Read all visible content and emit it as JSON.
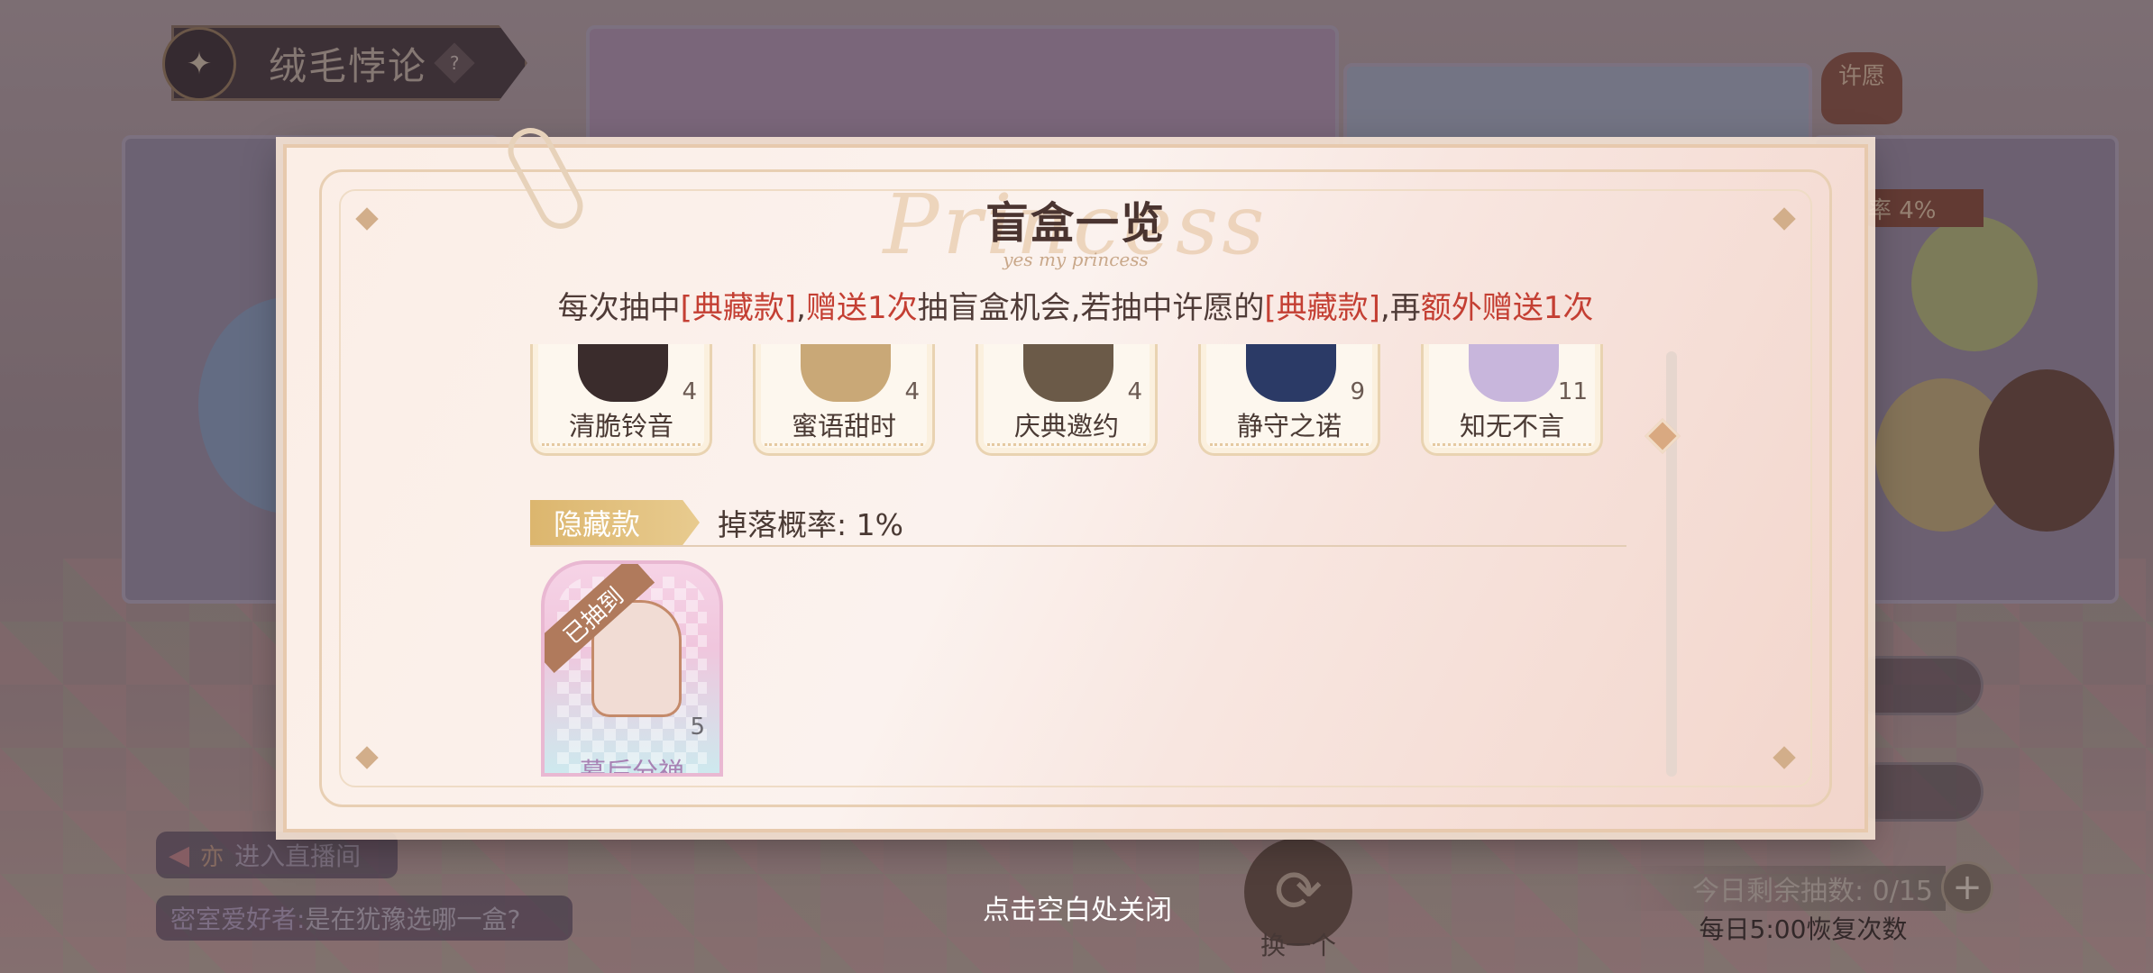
{
  "background": {
    "game_title": "绒毛悖论",
    "help_symbol": "?",
    "rate_badge": "率 4%",
    "wish_tag": "许愿",
    "live_button_tag": "亦",
    "live_button_label": "进入直播间",
    "chat_user": "密室爱好者:",
    "chat_message": "是在犹豫选哪一盒?",
    "swap_label": "换一个",
    "draws_remaining": "今日剩余抽数: 0/15",
    "plus_symbol": "+",
    "recover_text": "每日5:00恢复次数",
    "colors": {
      "accent_red": "#c43f33",
      "tag_gold": "#dcb66e",
      "modal_bg": "#fbeee6"
    }
  },
  "modal": {
    "title_deco": "Princess",
    "title": "盲盒一览",
    "subtitle": "yes my princess",
    "info": {
      "p1": "每次抽中",
      "p2": "[典藏款]",
      "p3": ",",
      "p4": "赠送1次",
      "p5": "抽盲盒机会,若抽中许愿的",
      "p6": "[典藏款]",
      "p7": ",再",
      "p8": "额外赠送1次"
    },
    "cards": [
      {
        "name": "清脆铃音",
        "count": "4"
      },
      {
        "name": "蜜语甜时",
        "count": "4"
      },
      {
        "name": "庆典邀约",
        "count": "4"
      },
      {
        "name": "静守之诺",
        "count": "9"
      },
      {
        "name": "知无不言",
        "count": "11"
      }
    ],
    "hidden_section": {
      "tag": "隐藏款",
      "rate": "掉落概率: 1%",
      "card": {
        "ribbon": "已抽到",
        "count": "5",
        "name": "暮后分禅"
      }
    }
  },
  "close_hint": "点击空白处关闭"
}
